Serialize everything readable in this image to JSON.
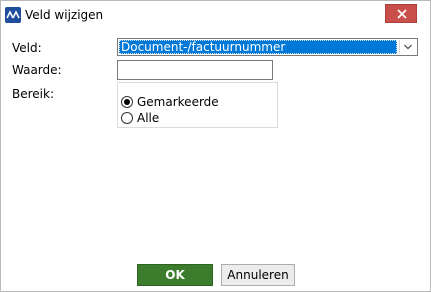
{
  "window": {
    "title": "Veld wijzigen",
    "app_icon": "app-logo-icon",
    "close_icon": "close-icon"
  },
  "form": {
    "veld_label": "Veld:",
    "veld_value": "Document-/factuurnummer",
    "waarde_label": "Waarde:",
    "waarde_value": "",
    "bereik_label": "Bereik:",
    "options": [
      {
        "label": "Gemarkeerde",
        "checked": true
      },
      {
        "label": "Alle",
        "checked": false
      }
    ]
  },
  "buttons": {
    "ok": "OK",
    "cancel": "Annuleren"
  },
  "colors": {
    "ok_bg": "#3b7d2c",
    "close_bg": "#c9504a",
    "selection": "#0078d7"
  }
}
